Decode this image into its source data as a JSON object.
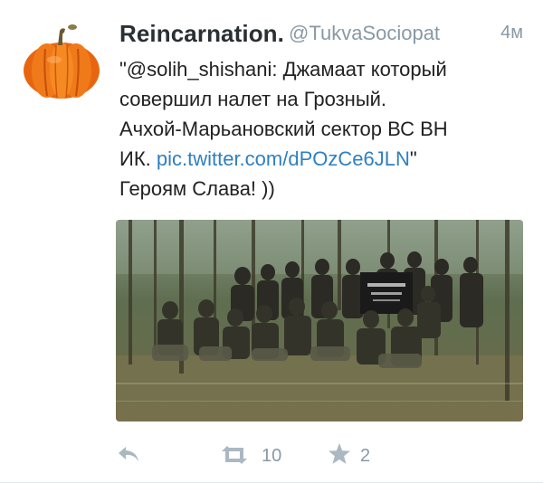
{
  "tweet": {
    "author_name": "Reincarnation.",
    "author_handle": "@TukvaSociopat",
    "time": "4м",
    "text_lines": [
      "\"@solih_shishani: Джамаат который",
      "совершил налет на Грозный.",
      "Ачхой-Марьановский сектор ВС ВН"
    ],
    "text_line4_prefix": "ИК. ",
    "link": "pic.twitter.com/dPOzCe6JLN",
    "text_line4_suffix": "\"",
    "text_line5": "Героям Слава! ))"
  },
  "actions": {
    "reply_icon": "reply-icon",
    "retweet_icon": "retweet-icon",
    "retweet_count": "10",
    "favorite_icon": "star-icon",
    "favorite_count": "2"
  },
  "colors": {
    "link": "#2f7fc1",
    "meta": "#8899a6",
    "name": "#2a2f33"
  }
}
